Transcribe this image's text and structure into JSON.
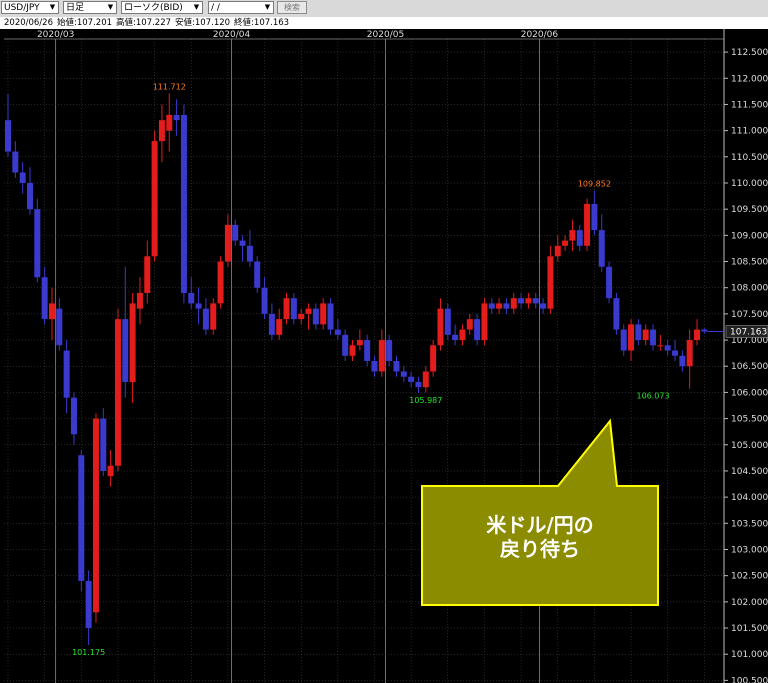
{
  "toolbar": {
    "symbol": "USD/JPY",
    "timeframe": "日足",
    "price_type": "ローソク(BID)",
    "date_value": " /  /",
    "search_label": "検索"
  },
  "info": {
    "date": "2020/06/26",
    "open": "始値:107.201",
    "high": "高値:107.227",
    "low": "安値:107.120",
    "close": "終値:107.163"
  },
  "callout": {
    "line1": "米ドル/円の",
    "line2": "戻り待ち"
  },
  "colors": {
    "up": "#e31c1c",
    "down": "#3a3acf",
    "grid": "#4a4a4a",
    "high_label": "#ff7a1a",
    "low_label": "#28e028",
    "callout_fill": "#8c8c00",
    "callout_border": "#ffff00"
  },
  "chart_data": {
    "type": "candlestick",
    "title": "",
    "x_ticks": [
      "2020/03",
      "2020/04",
      "2020/05",
      "2020/06"
    ],
    "x_tick_index": [
      7,
      31,
      52,
      73
    ],
    "ylim": [
      100.45,
      112.75
    ],
    "y_ticks": [
      "112.500",
      "112.000",
      "111.500",
      "111.000",
      "110.500",
      "110.000",
      "109.500",
      "109.000",
      "108.500",
      "108.000",
      "107.500",
      "107.000",
      "106.500",
      "106.000",
      "105.500",
      "105.000",
      "104.500",
      "104.000",
      "103.500",
      "103.000",
      "102.500",
      "102.000",
      "101.500",
      "101.000",
      "100.500"
    ],
    "last_price": "107.163",
    "annotations": [
      {
        "label": "111.712",
        "kind": "high",
        "index": 22,
        "price": 111.712
      },
      {
        "label": "101.175",
        "kind": "low",
        "index": 11,
        "price": 101.175
      },
      {
        "label": "109.852",
        "kind": "high",
        "index": 80,
        "price": 109.852
      },
      {
        "label": "105.987",
        "kind": "low",
        "index": 57,
        "price": 105.987
      },
      {
        "label": "106.073",
        "kind": "low",
        "index": 88,
        "price": 106.073
      }
    ],
    "ohlc": [
      [
        111.2,
        111.7,
        110.5,
        110.6
      ],
      [
        110.6,
        110.8,
        110.1,
        110.2
      ],
      [
        110.2,
        110.4,
        109.8,
        110.0
      ],
      [
        110.0,
        110.3,
        109.4,
        109.5
      ],
      [
        109.5,
        109.7,
        108.1,
        108.2
      ],
      [
        108.2,
        108.4,
        107.3,
        107.4
      ],
      [
        107.4,
        108.0,
        107.0,
        107.7
      ],
      [
        107.6,
        107.8,
        106.8,
        106.9
      ],
      [
        106.8,
        107.0,
        105.6,
        105.9
      ],
      [
        105.9,
        106.0,
        105.0,
        105.2
      ],
      [
        104.8,
        104.9,
        102.2,
        102.4
      ],
      [
        102.4,
        102.6,
        101.175,
        101.5
      ],
      [
        101.8,
        105.6,
        101.6,
        105.5
      ],
      [
        105.5,
        105.7,
        104.4,
        104.5
      ],
      [
        104.4,
        104.9,
        104.2,
        104.6
      ],
      [
        104.6,
        107.6,
        104.5,
        107.4
      ],
      [
        107.4,
        108.4,
        105.9,
        106.2
      ],
      [
        106.2,
        107.9,
        105.8,
        107.7
      ],
      [
        107.6,
        108.2,
        107.3,
        107.9
      ],
      [
        107.9,
        108.9,
        107.7,
        108.6
      ],
      [
        108.6,
        111.0,
        108.5,
        110.8
      ],
      [
        110.8,
        111.5,
        110.4,
        111.2
      ],
      [
        111.0,
        111.712,
        110.6,
        111.3
      ],
      [
        111.3,
        111.6,
        110.9,
        111.2
      ],
      [
        111.3,
        111.5,
        107.7,
        107.9
      ],
      [
        107.9,
        108.2,
        107.6,
        107.7
      ],
      [
        107.7,
        108.0,
        107.3,
        107.6
      ],
      [
        107.6,
        107.8,
        107.1,
        107.2
      ],
      [
        107.2,
        107.8,
        107.1,
        107.7
      ],
      [
        107.7,
        108.6,
        107.6,
        108.5
      ],
      [
        108.5,
        109.4,
        108.4,
        109.2
      ],
      [
        109.2,
        109.3,
        108.8,
        108.9
      ],
      [
        108.9,
        109.0,
        108.5,
        108.8
      ],
      [
        108.8,
        109.1,
        108.4,
        108.5
      ],
      [
        108.5,
        108.6,
        107.9,
        108.0
      ],
      [
        108.0,
        108.2,
        107.4,
        107.5
      ],
      [
        107.5,
        107.7,
        107.0,
        107.1
      ],
      [
        107.1,
        107.6,
        107.0,
        107.4
      ],
      [
        107.4,
        107.9,
        107.3,
        107.8
      ],
      [
        107.8,
        107.9,
        107.3,
        107.4
      ],
      [
        107.4,
        107.6,
        107.3,
        107.5
      ],
      [
        107.5,
        107.7,
        107.2,
        107.6
      ],
      [
        107.6,
        107.7,
        107.2,
        107.3
      ],
      [
        107.3,
        107.8,
        107.2,
        107.7
      ],
      [
        107.7,
        107.8,
        107.1,
        107.2
      ],
      [
        107.2,
        107.4,
        107.0,
        107.1
      ],
      [
        107.1,
        107.2,
        106.6,
        106.7
      ],
      [
        106.7,
        107.0,
        106.6,
        106.9
      ],
      [
        106.9,
        107.2,
        106.8,
        107.0
      ],
      [
        107.0,
        107.1,
        106.5,
        106.6
      ],
      [
        106.6,
        106.7,
        106.3,
        106.4
      ],
      [
        106.4,
        107.2,
        106.3,
        107.0
      ],
      [
        107.0,
        107.1,
        106.5,
        106.6
      ],
      [
        106.6,
        106.7,
        106.3,
        106.4
      ],
      [
        106.4,
        106.5,
        106.2,
        106.3
      ],
      [
        106.3,
        106.4,
        106.1,
        106.2
      ],
      [
        106.2,
        106.3,
        105.987,
        106.1
      ],
      [
        106.1,
        106.5,
        106.0,
        106.4
      ],
      [
        106.4,
        107.0,
        106.3,
        106.9
      ],
      [
        106.9,
        107.8,
        106.8,
        107.6
      ],
      [
        107.6,
        107.7,
        107.0,
        107.1
      ],
      [
        107.1,
        107.3,
        106.9,
        107.0
      ],
      [
        107.0,
        107.3,
        106.9,
        107.2
      ],
      [
        107.2,
        107.5,
        107.1,
        107.4
      ],
      [
        107.4,
        107.5,
        106.9,
        107.0
      ],
      [
        107.0,
        107.8,
        106.9,
        107.7
      ],
      [
        107.7,
        107.8,
        107.5,
        107.6
      ],
      [
        107.6,
        107.8,
        107.5,
        107.7
      ],
      [
        107.7,
        107.8,
        107.5,
        107.6
      ],
      [
        107.6,
        107.9,
        107.5,
        107.8
      ],
      [
        107.8,
        107.9,
        107.6,
        107.7
      ],
      [
        107.7,
        107.9,
        107.6,
        107.8
      ],
      [
        107.8,
        107.9,
        107.6,
        107.7
      ],
      [
        107.7,
        107.8,
        107.5,
        107.6
      ],
      [
        107.6,
        108.8,
        107.5,
        108.6
      ],
      [
        108.6,
        109.0,
        108.5,
        108.8
      ],
      [
        108.8,
        109.0,
        108.7,
        108.9
      ],
      [
        108.9,
        109.3,
        108.7,
        109.1
      ],
      [
        109.1,
        109.2,
        108.7,
        108.8
      ],
      [
        108.8,
        109.7,
        108.7,
        109.6
      ],
      [
        109.6,
        109.852,
        109.0,
        109.1
      ],
      [
        109.1,
        109.4,
        108.3,
        108.4
      ],
      [
        108.4,
        108.5,
        107.7,
        107.8
      ],
      [
        107.8,
        107.9,
        107.1,
        107.2
      ],
      [
        107.2,
        107.3,
        106.7,
        106.8
      ],
      [
        106.8,
        107.4,
        106.6,
        107.3
      ],
      [
        107.3,
        107.4,
        106.9,
        107.0
      ],
      [
        107.0,
        107.3,
        106.9,
        107.2
      ],
      [
        107.2,
        107.3,
        106.8,
        106.9
      ],
      [
        106.9,
        107.1,
        106.8,
        106.9
      ],
      [
        106.9,
        107.0,
        106.7,
        106.8
      ],
      [
        106.8,
        107.0,
        106.6,
        106.7
      ],
      [
        106.7,
        106.8,
        106.4,
        106.5
      ],
      [
        106.5,
        107.2,
        106.073,
        107.0
      ],
      [
        107.0,
        107.4,
        106.9,
        107.2
      ],
      [
        107.201,
        107.227,
        107.12,
        107.163
      ]
    ]
  }
}
